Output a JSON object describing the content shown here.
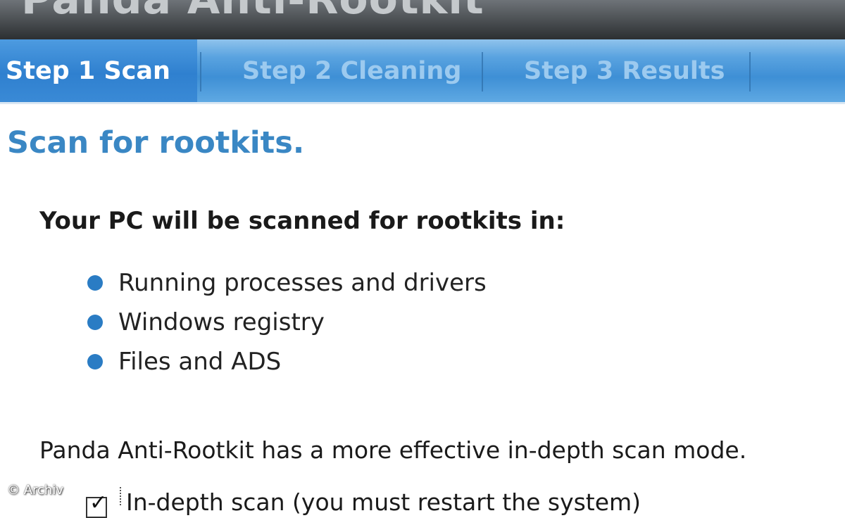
{
  "window": {
    "title": "Panda Anti-Rootkit"
  },
  "tabs": [
    {
      "label": "Step 1 Scan"
    },
    {
      "label": "Step 2 Cleaning"
    },
    {
      "label": "Step 3 Results"
    }
  ],
  "main": {
    "heading": "Scan for rootkits.",
    "intro": "Your PC will be scanned for rootkits in:",
    "items": [
      "Running processes and drivers",
      "Windows registry",
      "Files and ADS"
    ],
    "note": "Panda Anti-Rootkit has a more effective in-depth scan mode.",
    "checkbox": {
      "label": "In-depth scan (you must restart the system)",
      "checked": true
    }
  },
  "watermark": "© Archiv",
  "colors": {
    "accent": "#3a87c4",
    "tab_active": "#2f80cf",
    "bullet": "#2a7cc4"
  }
}
